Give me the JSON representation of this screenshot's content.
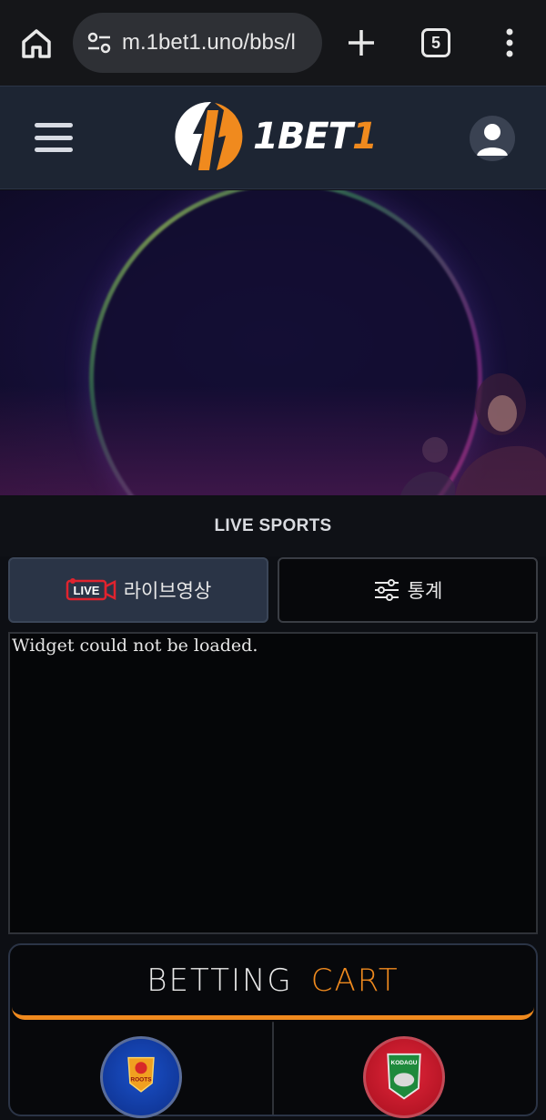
{
  "browser": {
    "url": "m.1bet1.uno/bbs/l",
    "tab_count": "5"
  },
  "site": {
    "logo_word_white": "1BET",
    "logo_word_orange": "1"
  },
  "live_sports": {
    "title": "LIVE SPORTS",
    "tabs": [
      {
        "label": "라이브영상",
        "icon_text": "LIVE"
      },
      {
        "label": "통계"
      }
    ],
    "widget_message": "Widget could not be loaded."
  },
  "betting_cart": {
    "title_part1": "BETTING",
    "title_part2": "CART",
    "home_team_badge_text": "ROOTS",
    "away_team_badge_text": "KODAGU"
  },
  "colors": {
    "accent": "#f08a1e",
    "header_bg": "#1d2533",
    "page_bg": "#0d0f14"
  }
}
